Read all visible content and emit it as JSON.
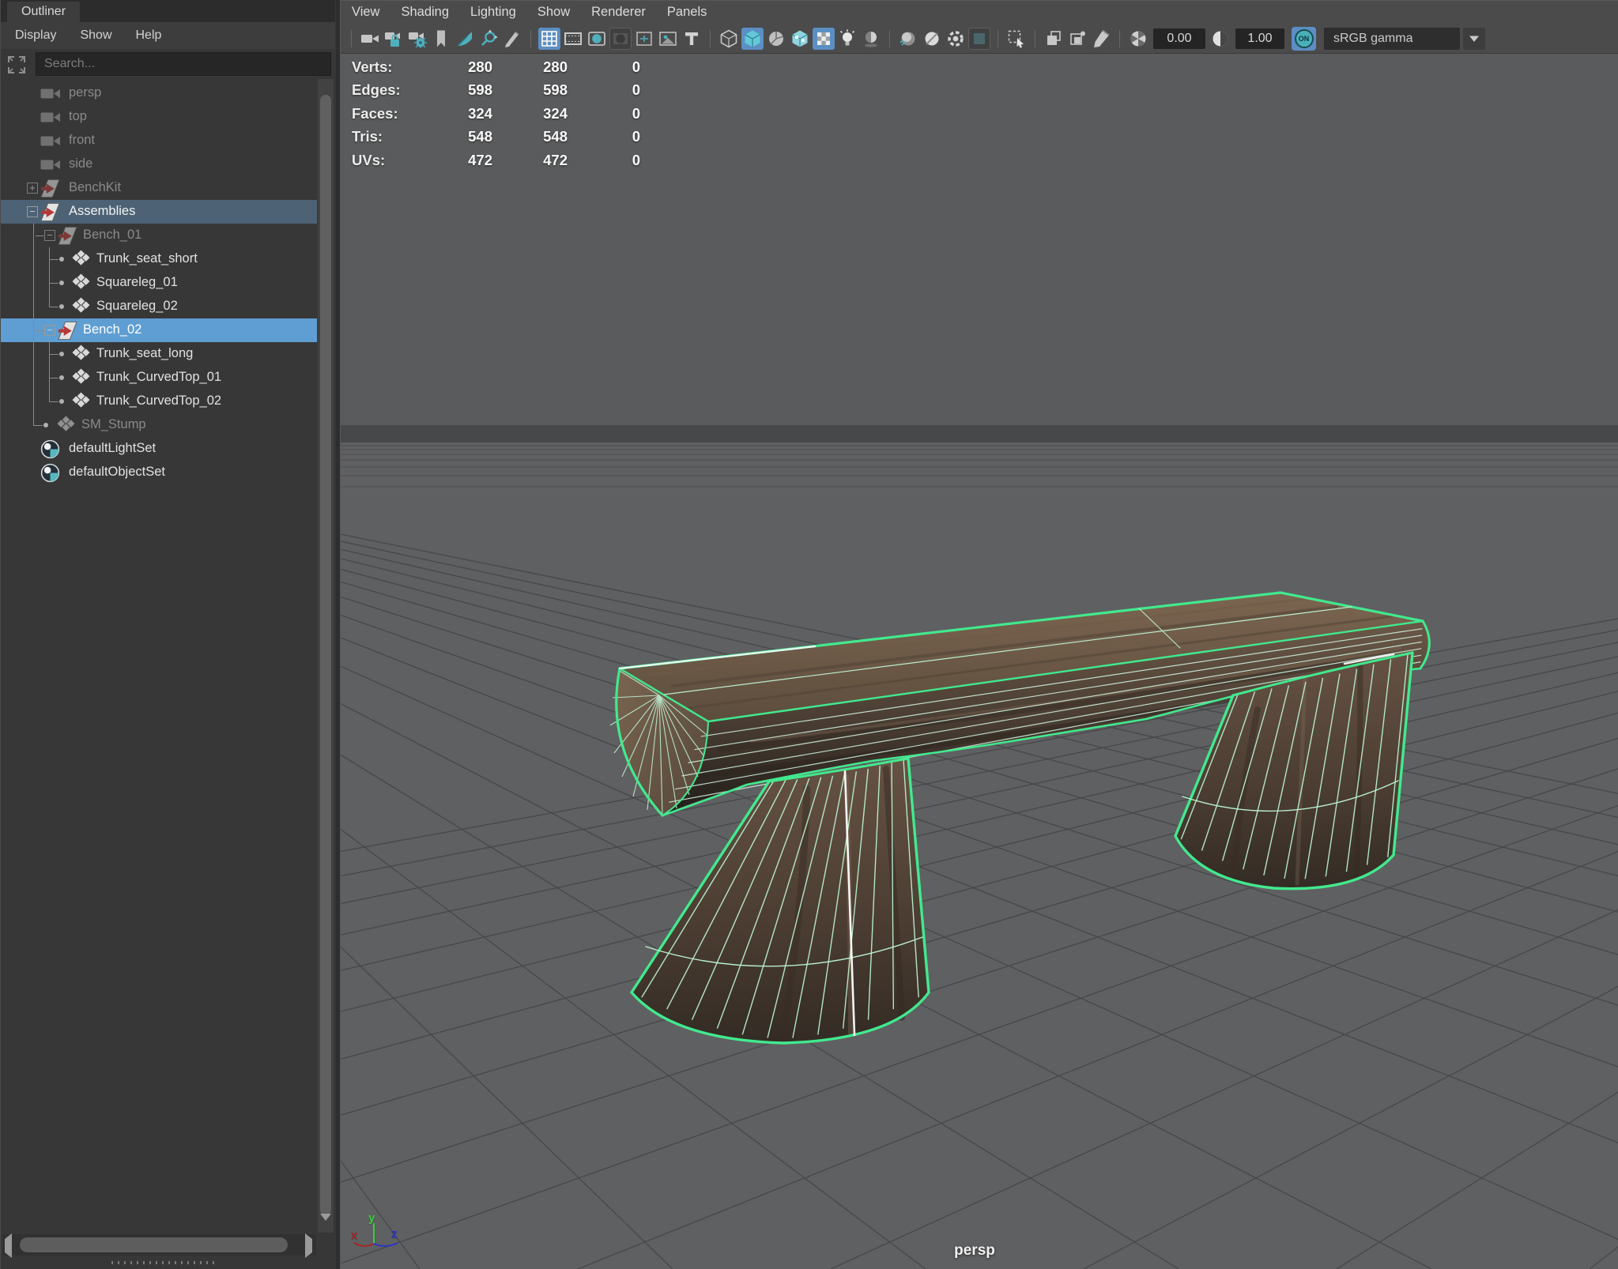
{
  "outliner": {
    "tab": "Outliner",
    "menus": [
      {
        "label": "Display"
      },
      {
        "label": "Show"
      },
      {
        "label": "Help"
      }
    ],
    "search_placeholder": "Search...",
    "items": [
      {
        "label": "persp",
        "icon": "camera-icon",
        "level": "1",
        "grayed": true
      },
      {
        "label": "top",
        "icon": "camera-icon",
        "level": "1",
        "grayed": true
      },
      {
        "label": "front",
        "icon": "camera-icon",
        "level": "1",
        "grayed": true
      },
      {
        "label": "side",
        "icon": "camera-icon",
        "level": "1",
        "grayed": true
      },
      {
        "label": "BenchKit",
        "icon": "assembly-icon",
        "level": "1",
        "expander": "plus",
        "grayed": true
      },
      {
        "label": "Assemblies",
        "icon": "assembly-icon",
        "level": "1",
        "expander": "minus",
        "selected": "secondary"
      },
      {
        "label": "Bench_01",
        "icon": "assembly-icon",
        "level": "2",
        "expander": "minus",
        "grayed": true
      },
      {
        "label": "Trunk_seat_short",
        "icon": "member-icon",
        "level": "3",
        "dot": true
      },
      {
        "label": "Squareleg_01",
        "icon": "member-icon",
        "level": "3",
        "dot": true
      },
      {
        "label": "Squareleg_02",
        "icon": "member-icon",
        "level": "3",
        "dot": true
      },
      {
        "label": "Bench_02",
        "icon": "assembly-icon",
        "level": "2",
        "expander": "minus",
        "selected": "primary"
      },
      {
        "label": "Trunk_seat_long",
        "icon": "member-icon",
        "level": "3",
        "dot": true
      },
      {
        "label": "Trunk_CurvedTop_01",
        "icon": "member-icon",
        "level": "3",
        "dot": true
      },
      {
        "label": "Trunk_CurvedTop_02",
        "icon": "member-icon",
        "level": "3",
        "dot": true
      },
      {
        "label": "SM_Stump",
        "icon": "member-icon",
        "level": "2m",
        "dot": true,
        "grayed": true
      },
      {
        "label": "defaultLightSet",
        "icon": "set-icon",
        "level": "1"
      },
      {
        "label": "defaultObjectSet",
        "icon": "set-icon",
        "level": "1"
      }
    ]
  },
  "viewport": {
    "menus": [
      {
        "label": "View"
      },
      {
        "label": "Shading"
      },
      {
        "label": "Lighting"
      },
      {
        "label": "Show"
      },
      {
        "label": "Renderer"
      },
      {
        "label": "Panels"
      }
    ],
    "toolbar": {
      "items": [
        {
          "kind": "sep"
        },
        {
          "kind": "btn",
          "name": "camera-icon"
        },
        {
          "kind": "btn",
          "name": "camera-lock-icon"
        },
        {
          "kind": "btn",
          "name": "camera-settings-icon"
        },
        {
          "kind": "btn",
          "name": "bookmark-icon"
        },
        {
          "kind": "btn",
          "name": "pan-zoom-2d-icon"
        },
        {
          "kind": "btn",
          "name": "zoom-region-icon"
        },
        {
          "kind": "btn",
          "name": "grease-pencil-icon"
        },
        {
          "kind": "sep"
        },
        {
          "kind": "btn",
          "name": "grid-icon",
          "active": true
        },
        {
          "kind": "btn",
          "name": "film-gate-icon"
        },
        {
          "kind": "btn",
          "name": "resolution-gate-icon"
        },
        {
          "kind": "btn",
          "name": "gate-mask-icon",
          "pressed": true
        },
        {
          "kind": "btn",
          "name": "field-chart-icon"
        },
        {
          "kind": "btn",
          "name": "image-plane-icon"
        },
        {
          "kind": "btn",
          "name": "hud-toggle-icon"
        },
        {
          "kind": "sep"
        },
        {
          "kind": "btn",
          "name": "wireframe-icon"
        },
        {
          "kind": "btn",
          "name": "smooth-shade-icon",
          "active": true
        },
        {
          "kind": "btn",
          "name": "wireframe-on-shaded-icon"
        },
        {
          "kind": "btn",
          "name": "textured-icon"
        },
        {
          "kind": "btn",
          "name": "use-default-material-icon",
          "active": true
        },
        {
          "kind": "btn",
          "name": "lights-icon"
        },
        {
          "kind": "btn",
          "name": "shadows-icon"
        },
        {
          "kind": "sep"
        },
        {
          "kind": "btn",
          "name": "occlusion-icon"
        },
        {
          "kind": "btn",
          "name": "anti-aliasing-icon"
        },
        {
          "kind": "btn",
          "name": "motion-blur-icon"
        },
        {
          "kind": "btn",
          "name": "depth-of-field-icon",
          "pressed": true
        },
        {
          "kind": "sep"
        },
        {
          "kind": "btn",
          "name": "object-selection-icon"
        },
        {
          "kind": "sep"
        },
        {
          "kind": "btn",
          "name": "isolate-select-icon"
        },
        {
          "kind": "btn",
          "name": "isolate-add-icon"
        },
        {
          "kind": "btn",
          "name": "xray-icon"
        },
        {
          "kind": "sep"
        },
        {
          "kind": "btn",
          "name": "exposure-icon"
        },
        {
          "kind": "field",
          "name": "exposure-field",
          "text": "0.00"
        },
        {
          "kind": "btn",
          "name": "contrast-icon"
        },
        {
          "kind": "field",
          "name": "contrast-field",
          "text": "1.00"
        },
        {
          "kind": "onbtn",
          "name": "color-management-toggle",
          "text": "ON",
          "active": true
        },
        {
          "kind": "select",
          "name": "colorspace-select",
          "text": "sRGB gamma"
        },
        {
          "kind": "selectarrow",
          "name": "colorspace-dropdown-button"
        }
      ]
    },
    "hud": {
      "rows": [
        {
          "label": "Verts:",
          "values": [
            "280",
            "280",
            "0"
          ]
        },
        {
          "label": "Edges:",
          "values": [
            "598",
            "598",
            "0"
          ]
        },
        {
          "label": "Faces:",
          "values": [
            "324",
            "324",
            "0"
          ]
        },
        {
          "label": "Tris:",
          "values": [
            "548",
            "548",
            "0"
          ]
        },
        {
          "label": "UVs:",
          "values": [
            "472",
            "472",
            "0"
          ]
        }
      ]
    },
    "camera_label": "persp",
    "axis": {
      "x": "x",
      "y": "y",
      "z": "z"
    }
  },
  "colors": {
    "selection_primary": "#5e9ed2",
    "selection_secondary": "#4d6275",
    "accent_teal": "#4fb0bd",
    "active_button": "#5b8fc3",
    "wireframe_green": "#42e98e",
    "viewport_gray": "#5a5b5c"
  }
}
